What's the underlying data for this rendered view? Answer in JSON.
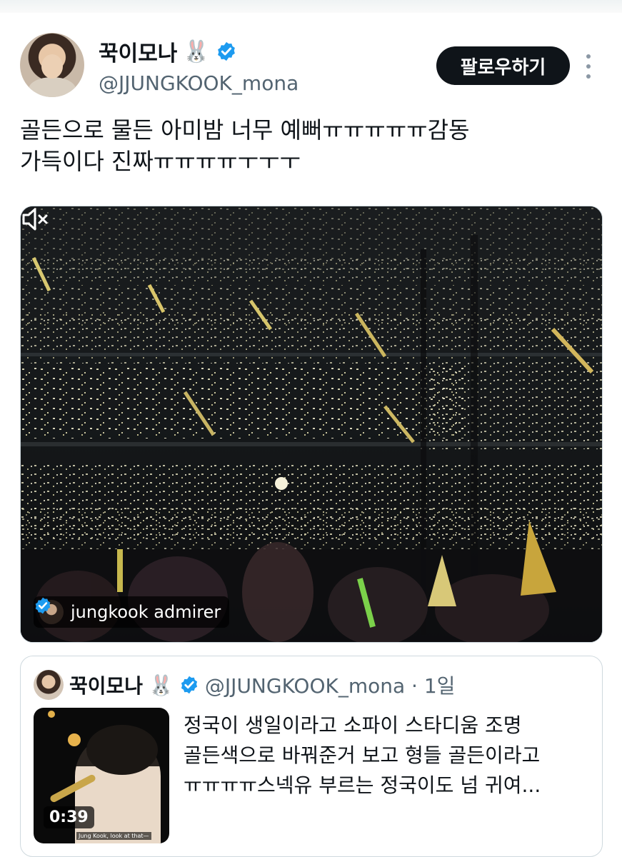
{
  "tweet": {
    "display_name": "꾹이모나",
    "name_emoji": "🐰",
    "handle": "@JJUNGKOOK_mona",
    "follow_label": "팔로우하기",
    "text": "골든으로 물든 아미밤 너무 예뻐ㅠㅠㅠㅠㅠ감동\n가득이다 진짜ㅠㅠㅠㅠㅜㅜㅜ"
  },
  "media": {
    "attribution": "jungkook admirer"
  },
  "quoted_tweet": {
    "display_name": "꾹이모나",
    "name_emoji": "🐰",
    "handle_time": "@JJUNGKOOK_mona · 1일",
    "duration": "0:39",
    "text": "정국이 생일이라고 소파이 스타디움 조명\n골든색으로 바꿔준거 보고 형들 골든이라고\nㅠㅠㅠㅠ스넥유 부르는 정국이도 넘 귀여..."
  },
  "colors": {
    "verified": "#1d9bf0",
    "text": "#0f1419",
    "secondary": "#536471",
    "border": "#cfd9de"
  },
  "icons": [
    "verified-badge-icon",
    "more-options-icon",
    "muted-speaker-icon"
  ]
}
